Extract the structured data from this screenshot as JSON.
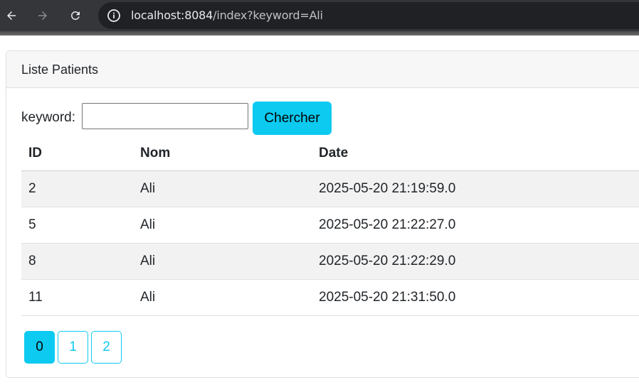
{
  "browser": {
    "url_host": "localhost:8084",
    "url_path": "/index?keyword=Ali"
  },
  "card": {
    "title": "Liste Patients"
  },
  "search": {
    "label": "keyword:",
    "value": "",
    "button_label": "Chercher"
  },
  "table": {
    "headers": [
      "ID",
      "Nom",
      "Date"
    ],
    "rows": [
      [
        "2",
        "Ali",
        "2025-05-20 21:19:59.0"
      ],
      [
        "5",
        "Ali",
        "2025-05-20 21:22:27.0"
      ],
      [
        "8",
        "Ali",
        "2025-05-20 21:22:29.0"
      ],
      [
        "11",
        "Ali",
        "2025-05-20 21:31:50.0"
      ]
    ]
  },
  "pagination": {
    "pages": [
      "0",
      "1",
      "2"
    ],
    "active": "0"
  },
  "colors": {
    "accent": "#0dcaf0",
    "toolbar": "#35363a",
    "omnibox": "#202124"
  },
  "icons": [
    "back-arrow-icon",
    "forward-arrow-icon",
    "reload-icon",
    "info-icon"
  ]
}
